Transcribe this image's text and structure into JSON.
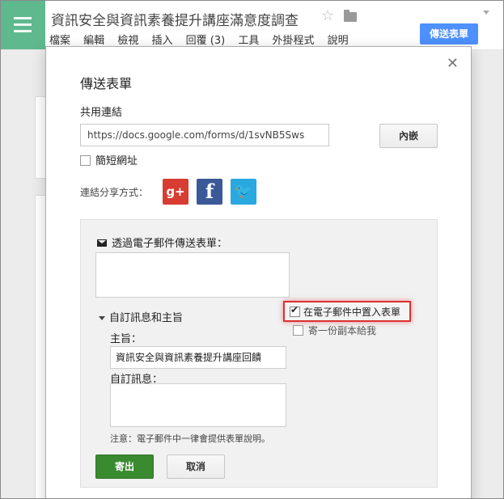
{
  "app": {
    "doc_title": "資訊安全與資訊素養提升講座滿意度調查",
    "menu": [
      "檔案",
      "編輯",
      "檢視",
      "插入",
      "回覆 (3)",
      "工具",
      "外掛程式",
      "說明"
    ],
    "send_form_button": "傳送表單"
  },
  "dialog": {
    "title": "傳送表單",
    "share_link_label": "共用連結",
    "share_link_value": "https://docs.google.com/forms/d/1svNB5Sws",
    "embed_button": "內嵌",
    "shorten_url_label": "簡短網址",
    "share_via_label": "連結分享方式：",
    "social": {
      "gplus": "g+",
      "facebook": "f",
      "twitter": "🐦"
    },
    "email": {
      "section_label": "透過電子郵件傳送表單：",
      "custom_toggle_label": "自訂訊息和主旨",
      "include_form_label": "在電子郵件中置入表單",
      "send_copy_label": "寄一份副本給我",
      "subject_label": "主旨：",
      "subject_value": "資訊安全與資訊素養提升講座回饋",
      "custom_message_label": "自訂訊息：",
      "note": "注意：電子郵件中一律會提供表單說明。",
      "send_button": "寄出",
      "cancel_button": "取消"
    }
  },
  "colors": {
    "accent_blue": "#4d90fe",
    "send_green": "#3a8a2f",
    "highlight_red": "#dd3030",
    "forms_green": "#5fb98e"
  }
}
